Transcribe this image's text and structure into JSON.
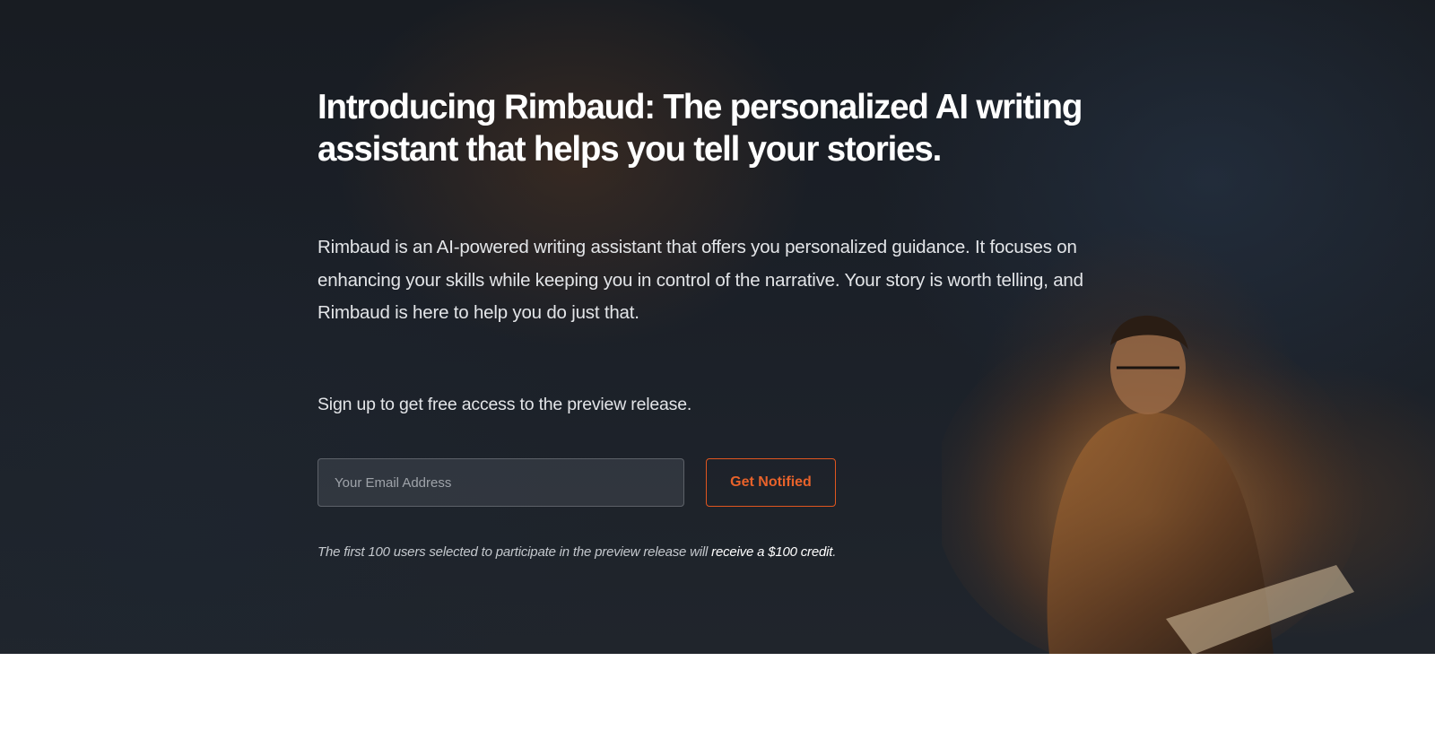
{
  "hero": {
    "headline": "Introducing Rimbaud: The personalized AI writing assistant that helps you tell your stories.",
    "description": "Rimbaud is an AI-powered writing assistant that offers you personalized guidance. It focuses on enhancing your skills while keeping you in control of the narrative. Your story is worth telling, and Rimbaud is here to help you do just that.",
    "signup_prompt": "Sign up to get free access to the preview release.",
    "background_image": "person-reading-by-firelight-at-night"
  },
  "form": {
    "email_placeholder": "Your Email Address",
    "email_value": "",
    "submit_label": "Get Notified"
  },
  "note": {
    "text": "The first 100 users selected to participate in the preview release will",
    "highlight": "receive a $100 credit",
    "suffix": "."
  },
  "colors": {
    "accent": "#e0561f",
    "hero_background": "#1b2028",
    "page_background": "#ffffff"
  }
}
